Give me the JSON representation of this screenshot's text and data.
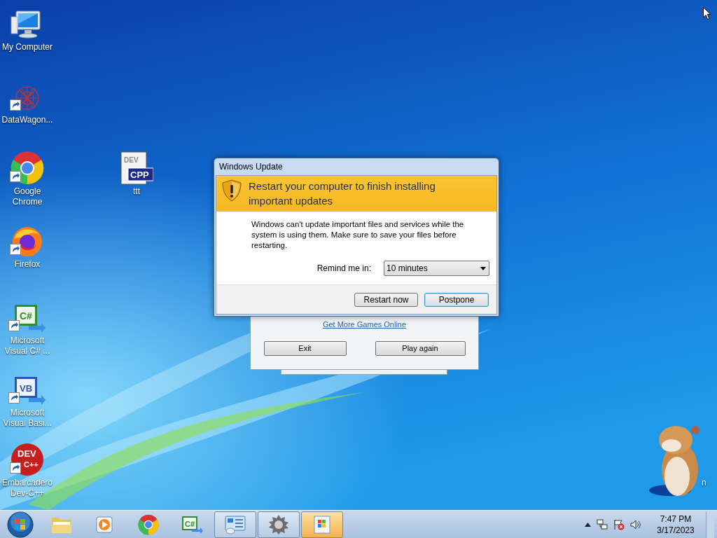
{
  "desktop": {
    "icons": [
      {
        "kind": "computer",
        "label": "My Computer",
        "shortcut": false
      },
      {
        "kind": "datawagon",
        "label": "DataWagon...",
        "shortcut": true
      },
      {
        "kind": "chrome",
        "label": "Google Chrome",
        "shortcut": true
      },
      {
        "kind": "firefox",
        "label": "Firefox",
        "shortcut": true
      },
      {
        "kind": "csharp",
        "label": "Microsoft Visual C# ...",
        "shortcut": true,
        "icon_text": [
          "C#"
        ]
      },
      {
        "kind": "vb",
        "label": "Microsoft Visual Basi...",
        "shortcut": true,
        "icon_text": [
          "VB"
        ]
      },
      {
        "kind": "devcpp",
        "label": "Embarcadero Dev-C++",
        "shortcut": true,
        "icon_text": [
          "DEV",
          "C++"
        ]
      },
      {
        "kind": "cppfile",
        "label": "ttt",
        "shortcut": false,
        "icon_text": [
          "DEV",
          "CPP"
        ]
      },
      {
        "kind": "hamster",
        "label": "n",
        "shortcut": false
      }
    ]
  },
  "game_window": {
    "link": "Get More Games Online",
    "buttons": [
      {
        "label": "Exit"
      },
      {
        "label": "Play again"
      }
    ]
  },
  "update_dialog": {
    "title": "Windows Update",
    "heading": "Restart your computer to finish installing important updates",
    "message": "Windows can't update important files and services while the system is using them. Make sure to save your files before restarting.",
    "remind_label": "Remind me in:",
    "remind_value": "10 minutes",
    "buttons": [
      {
        "label": "Restart now",
        "default": false
      },
      {
        "label": "Postpone",
        "default": true
      }
    ]
  },
  "taskbar": {
    "items": [
      {
        "kind": "explorer",
        "running": false,
        "flashing": false
      },
      {
        "kind": "media",
        "running": false,
        "flashing": false
      },
      {
        "kind": "chrome",
        "running": false,
        "flashing": false
      },
      {
        "kind": "csharp",
        "running": false,
        "flashing": false,
        "icon_text": "C#"
      },
      {
        "kind": "panel",
        "running": true,
        "flashing": false
      },
      {
        "kind": "gear",
        "running": true,
        "flashing": false
      },
      {
        "kind": "update",
        "running": true,
        "flashing": true
      }
    ],
    "clock": {
      "time": "7:47 PM",
      "date": "3/17/2023"
    }
  }
}
